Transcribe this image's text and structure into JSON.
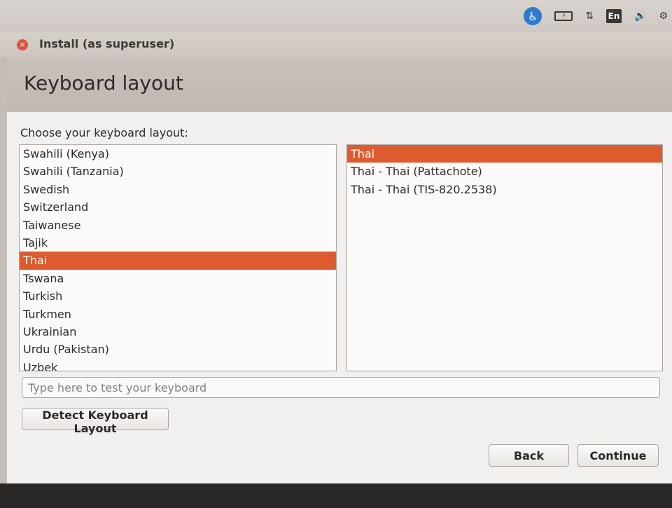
{
  "top_panel": {
    "indicators": [
      {
        "icon": "accessibility-icon",
        "glyph": "♿"
      },
      {
        "icon": "battery-icon",
        "glyph": "⚡"
      },
      {
        "icon": "network-icon",
        "glyph": "⇅"
      },
      {
        "icon": "keyboard-layout-icon",
        "glyph": "En"
      },
      {
        "icon": "volume-icon",
        "glyph": "🔊"
      },
      {
        "icon": "power-settings-icon",
        "glyph": "⚙"
      }
    ]
  },
  "window": {
    "title": "Install (as superuser)",
    "close_glyph": "×"
  },
  "header": {
    "title": "Keyboard layout"
  },
  "content": {
    "choose_label": "Choose your keyboard layout:",
    "layouts": [
      "Swahili (Kenya)",
      "Swahili (Tanzania)",
      "Swedish",
      "Switzerland",
      "Taiwanese",
      "Tajik",
      "Thai",
      "Tswana",
      "Turkish",
      "Turkmen",
      "Ukrainian",
      "Urdu (Pakistan)",
      "Uzbek"
    ],
    "selected_layout": "Thai",
    "variants": [
      "Thai",
      "Thai - Thai (Pattachote)",
      "Thai - Thai (TIS-820.2538)"
    ],
    "selected_variant": "Thai",
    "test_placeholder": "Type here to test your keyboard",
    "detect_button": "Detect Keyboard Layout"
  },
  "footer": {
    "back_button": "Back",
    "continue_button": "Continue"
  },
  "colors": {
    "accent": "#dd5b2e",
    "panel": "#cfc8c3",
    "close": "#e0513a"
  }
}
